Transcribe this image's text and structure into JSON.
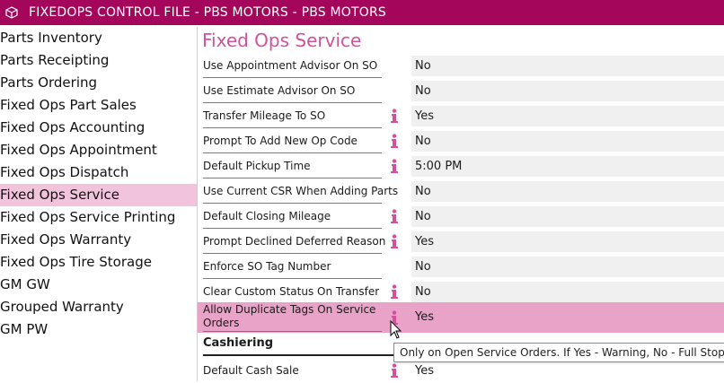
{
  "window": {
    "title": "FIXEDOPS CONTROL FILE - PBS MOTORS - PBS MOTORS"
  },
  "colors": {
    "accent": "#a4065c",
    "title_pink": "#d0529a",
    "active_item": "#f2c4dc",
    "highlight_row": "#e9a3c8",
    "info_icon": "#d0529a"
  },
  "sidebar": {
    "items": [
      {
        "label": "Parts Inventory"
      },
      {
        "label": "Parts Receipting"
      },
      {
        "label": "Parts Ordering"
      },
      {
        "label": "Fixed Ops Part Sales"
      },
      {
        "label": "Fixed Ops Accounting"
      },
      {
        "label": "Fixed Ops Appointment"
      },
      {
        "label": "Fixed Ops Dispatch"
      },
      {
        "label": "Fixed Ops Service"
      },
      {
        "label": "Fixed Ops Service Printing"
      },
      {
        "label": "Fixed Ops Warranty"
      },
      {
        "label": "Fixed Ops Tire Storage"
      },
      {
        "label": "GM GW"
      },
      {
        "label": "Grouped Warranty"
      },
      {
        "label": "GM PW"
      }
    ],
    "selected": "Fixed Ops Service"
  },
  "main": {
    "title": "Fixed Ops Service",
    "settings": [
      {
        "label": "Use Appointment Advisor On SO",
        "value": "No",
        "info": false
      },
      {
        "label": "Use Estimate Advisor On SO",
        "value": "No",
        "info": false
      },
      {
        "label": "Transfer Mileage To SO",
        "value": "Yes",
        "info": true
      },
      {
        "label": "Prompt To Add New Op Code",
        "value": "No",
        "info": true
      },
      {
        "label": "Default Pickup Time",
        "value": "5:00 PM",
        "info": true
      },
      {
        "label": "Use Current CSR When Adding Parts",
        "value": "No",
        "info": false
      },
      {
        "label": "Default Closing Mileage",
        "value": "No",
        "info": true
      },
      {
        "label": "Prompt Declined Deferred Reason",
        "value": "Yes",
        "info": true
      },
      {
        "label": "Enforce SO Tag Number",
        "value": "No",
        "info": false
      },
      {
        "label": "Clear Custom Status On Transfer",
        "value": "No",
        "info": true
      },
      {
        "label": "Allow Duplicate Tags On Service Orders",
        "value": "Yes",
        "info": true
      }
    ],
    "section": "Cashiering",
    "cashiering": [
      {
        "label": "Default Cash Sale",
        "value": "Yes",
        "info": true
      }
    ],
    "tooltip": "Only on Open Service Orders. If Yes - Warning, No - Full Stop"
  }
}
